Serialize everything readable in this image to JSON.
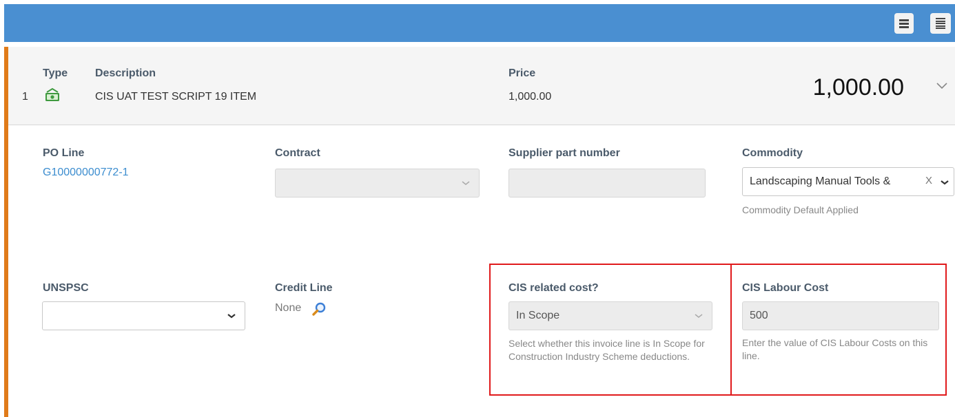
{
  "toolbar": {
    "view_buttons": [
      {
        "icon": "compact-list-icon"
      },
      {
        "icon": "detailed-list-icon"
      }
    ]
  },
  "colors": {
    "topbar": "#4a8fd1",
    "accent": "#e07b1a",
    "link": "#3c8dcf",
    "highlight": "#e0191b"
  },
  "line": {
    "number": "1",
    "type_label": "Type",
    "type_icon": "money-icon",
    "description_label": "Description",
    "description": "CIS UAT TEST SCRIPT 19 ITEM",
    "price_label": "Price",
    "price": "1,000.00",
    "total": "1,000.00"
  },
  "fields": {
    "po_line": {
      "label": "PO Line",
      "value": "G10000000772-1"
    },
    "contract": {
      "label": "Contract",
      "value": ""
    },
    "supplier_part": {
      "label": "Supplier part number",
      "value": ""
    },
    "commodity": {
      "label": "Commodity",
      "value": "Landscaping Manual Tools &",
      "clear": "X",
      "help": "Commodity Default Applied"
    },
    "unspsc": {
      "label": "UNSPSC",
      "value": ""
    },
    "credit_line": {
      "label": "Credit Line",
      "value": "None"
    },
    "cis_related": {
      "label": "CIS related cost?",
      "value": "In Scope",
      "help": "Select whether this invoice line is In Scope for Construction Industry Scheme deductions."
    },
    "cis_labour": {
      "label": "CIS Labour Cost",
      "value": "500",
      "help": "Enter the value of CIS Labour Costs on this line."
    }
  }
}
